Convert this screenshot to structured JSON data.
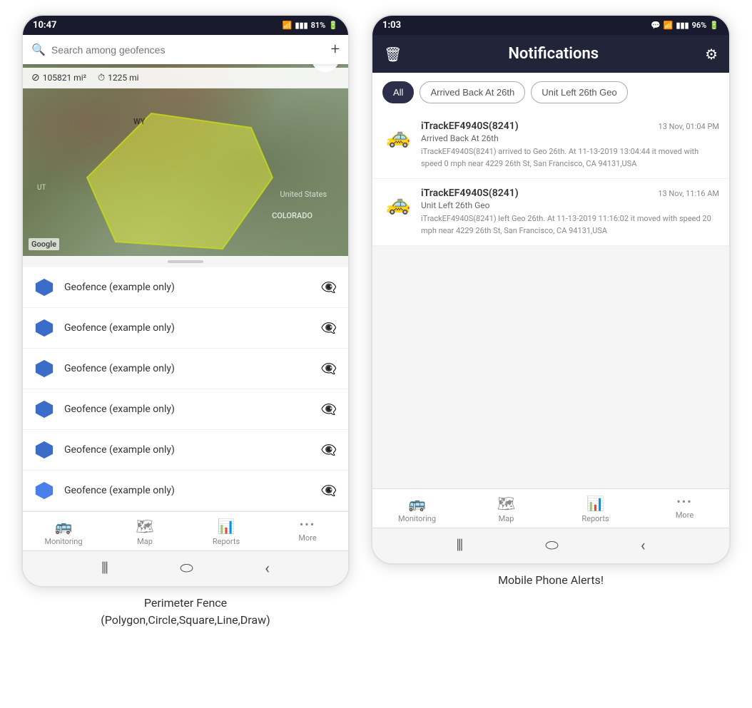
{
  "left_phone": {
    "status_bar": {
      "time": "10:47",
      "signal": "WiFi",
      "battery": "81%"
    },
    "search": {
      "placeholder": "Search among geofences"
    },
    "stats": {
      "area": "105821 mi²",
      "distance": "1225 mi"
    },
    "map_labels": {
      "wy": "WY",
      "colorado": "COLORADO",
      "us": "United States",
      "ut": "UT",
      "google": "Google"
    },
    "geofences": [
      {
        "name": "Geofence (example only)"
      },
      {
        "name": "Geofence (example only)"
      },
      {
        "name": "Geofence (example only)"
      },
      {
        "name": "Geofence (example only)"
      },
      {
        "name": "Geofence (example only)"
      },
      {
        "name": "Geofence (example only)"
      }
    ],
    "nav": {
      "items": [
        {
          "label": "Monitoring",
          "icon": "🚌"
        },
        {
          "label": "Map",
          "icon": "🗺"
        },
        {
          "label": "Reports",
          "icon": "📊"
        },
        {
          "label": "More",
          "icon": "•••"
        }
      ]
    },
    "caption": "Perimeter Fence\n(Polygon,Circle,Square,Line,Draw)"
  },
  "right_phone": {
    "status_bar": {
      "time": "1:03",
      "battery": "96%"
    },
    "header": {
      "title": "Notifications",
      "left_icon": "trash",
      "right_icon": "settings"
    },
    "filters": [
      {
        "label": "All",
        "active": true
      },
      {
        "label": "Arrived Back At 26th",
        "active": false
      },
      {
        "label": "Unit Left 26th Geo",
        "active": false
      }
    ],
    "notifications": [
      {
        "vehicle": "iTrackEF4940S(8241)",
        "time": "13 Nov, 01:04 PM",
        "event": "Arrived Back At 26th",
        "body": "iTrackEF4940S(8241) arrived to Geo 26th.   At 11-13-2019 13:04:44 it moved with speed 0 mph near 4229 26th St, San Francisco, CA 94131,USA"
      },
      {
        "vehicle": "iTrackEF4940S(8241)",
        "time": "13 Nov, 11:16 AM",
        "event": "Unit Left 26th Geo",
        "body": "iTrackEF4940S(8241) left Geo 26th.   At 11-13-2019 11:16:02 it moved with speed 20 mph near 4229 26th St, San Francisco, CA 94131,USA"
      }
    ],
    "nav": {
      "items": [
        {
          "label": "Monitoring",
          "icon": "🚌"
        },
        {
          "label": "Map",
          "icon": "🗺"
        },
        {
          "label": "Reports",
          "icon": "📊"
        },
        {
          "label": "More",
          "icon": "•••"
        }
      ]
    },
    "caption": "Mobile Phone Alerts!"
  }
}
